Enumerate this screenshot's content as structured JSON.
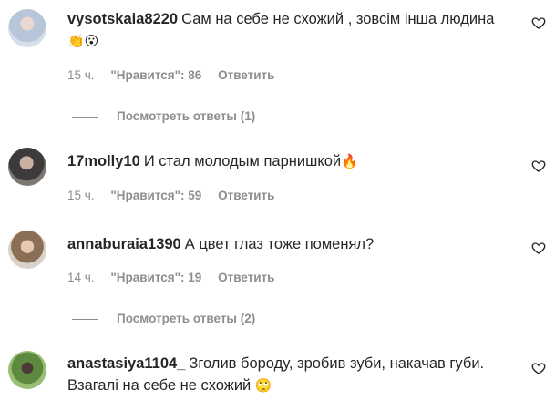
{
  "comments": [
    {
      "username": "vysotskaia8220",
      "text": "Сам на себе не схожий , зовсім інша людина",
      "emoji": "👏😮",
      "time": "15 ч.",
      "likes": "\"Нравится\": 86",
      "reply": "Ответить",
      "view_replies": "Посмотреть ответы (1)"
    },
    {
      "username": "17molly10",
      "text": "И стал молодым парнишкой",
      "emoji": "🔥",
      "time": "15 ч.",
      "likes": "\"Нравится\": 59",
      "reply": "Ответить"
    },
    {
      "username": "annaburaia1390",
      "text": "А цвет глаз тоже поменял?",
      "emoji": "",
      "time": "14 ч.",
      "likes": "\"Нравится\": 19",
      "reply": "Ответить",
      "view_replies": "Посмотреть ответы (2)"
    },
    {
      "username": "anastasiya1104_",
      "text": "Зголив бороду, зробив зуби, накачав губи. Взагалі на себе не схожий",
      "emoji": "🙄"
    }
  ],
  "icons": {
    "like": "heart-outline-icon"
  },
  "colors": {
    "text": "#262626",
    "secondary": "#8e8e8e"
  }
}
